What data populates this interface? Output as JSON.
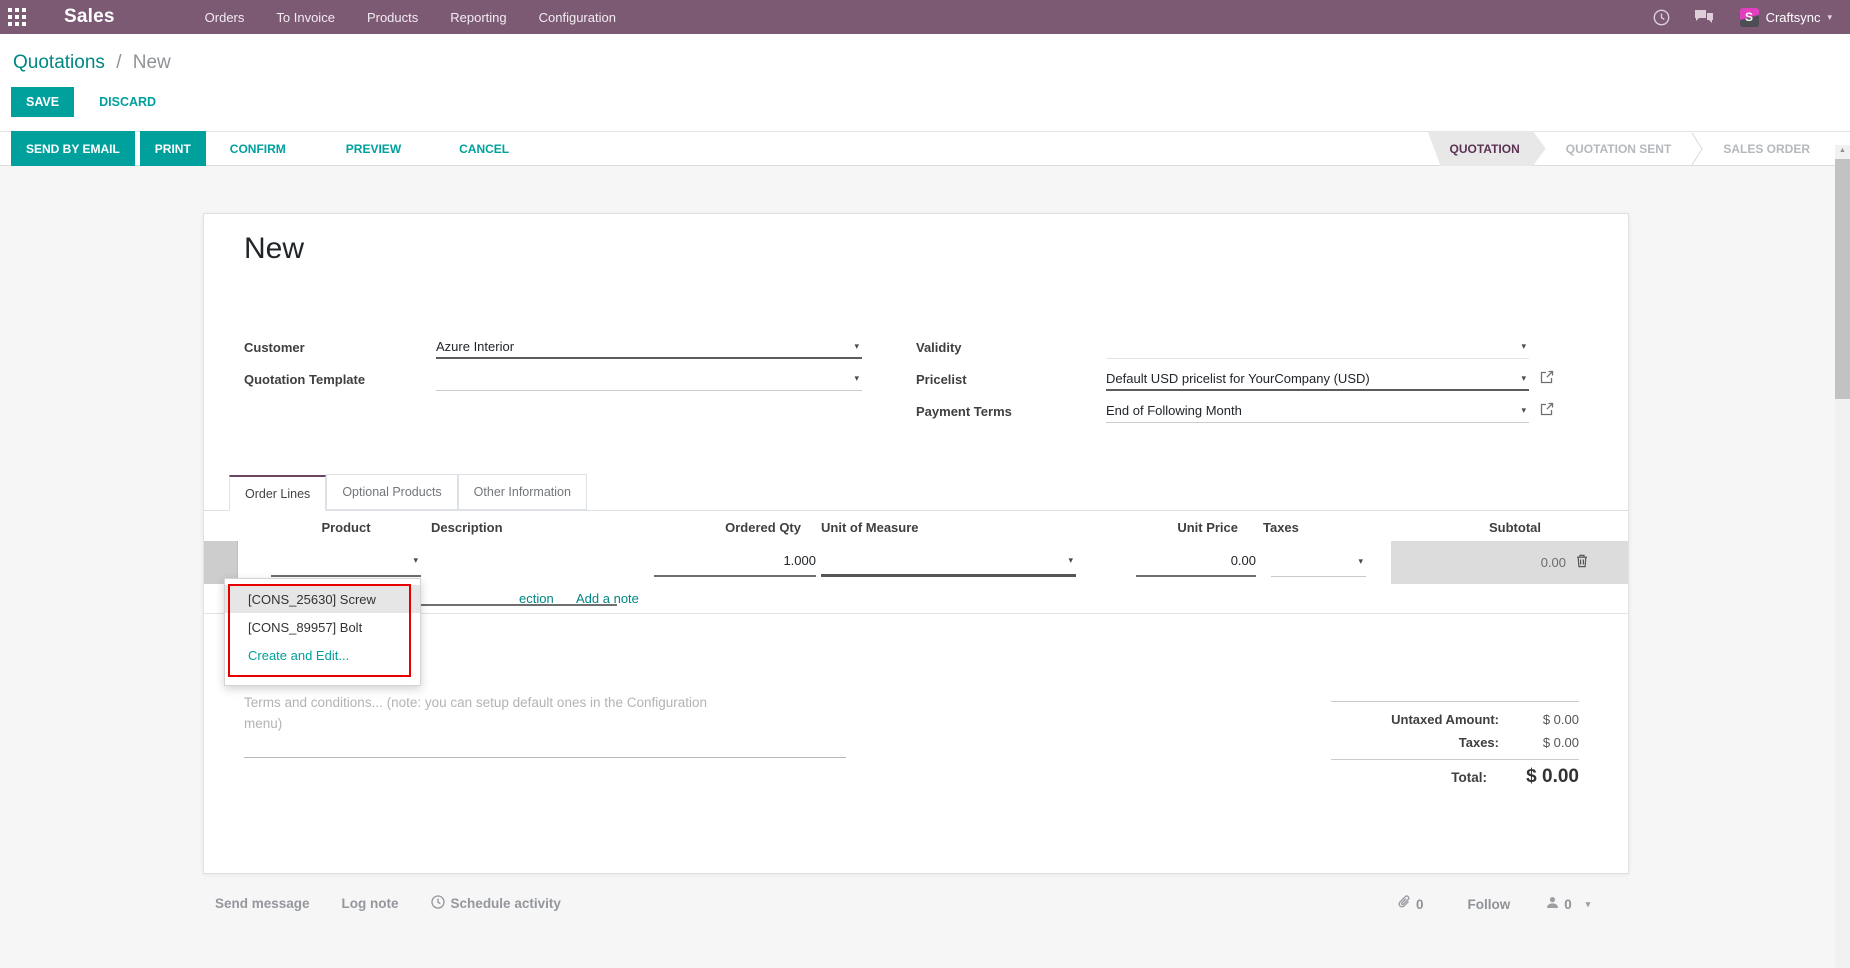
{
  "topbar": {
    "app_name": "Sales",
    "menu": [
      "Orders",
      "To Invoice",
      "Products",
      "Reporting",
      "Configuration"
    ],
    "user_name": "Craftsync",
    "avatar_letter": "S"
  },
  "breadcrumb": {
    "section": "Quotations",
    "separator": "/",
    "current": "New"
  },
  "control_buttons": {
    "save": "SAVE",
    "discard": "DISCARD"
  },
  "statusbar": {
    "send_by_email": "SEND BY EMAIL",
    "print": "PRINT",
    "confirm": "CONFIRM",
    "preview": "PREVIEW",
    "cancel": "CANCEL",
    "stages": [
      "QUOTATION",
      "QUOTATION SENT",
      "SALES ORDER"
    ],
    "active_stage": "QUOTATION"
  },
  "form": {
    "title": "New",
    "customer": {
      "label": "Customer",
      "value": "Azure Interior"
    },
    "quotation_template": {
      "label": "Quotation Template",
      "value": ""
    },
    "validity": {
      "label": "Validity",
      "value": ""
    },
    "pricelist": {
      "label": "Pricelist",
      "value": "Default USD pricelist for YourCompany (USD)"
    },
    "payment_terms": {
      "label": "Payment Terms",
      "value": "End of Following Month"
    }
  },
  "tabs": [
    "Order Lines",
    "Optional Products",
    "Other Information"
  ],
  "order_lines": {
    "columns": [
      "Product",
      "Description",
      "Ordered Qty",
      "Unit of Measure",
      "Unit Price",
      "Taxes",
      "Subtotal"
    ],
    "row": {
      "ordered_qty": "1.000",
      "unit_price": "0.00",
      "subtotal": "0.00"
    },
    "links": {
      "add_section_partial": "ection",
      "add_note": "Add a note"
    }
  },
  "product_dropdown": {
    "options": [
      "[CONS_25630] Screw",
      "[CONS_89957] Bolt"
    ],
    "create_option": "Create and Edit..."
  },
  "terms": {
    "placeholder": "Terms and conditions... (note: you can setup default ones in the Configuration menu)"
  },
  "totals": {
    "untaxed_label": "Untaxed Amount:",
    "untaxed_value": "$ 0.00",
    "taxes_label": "Taxes:",
    "taxes_value": "$ 0.00",
    "total_label": "Total:",
    "total_value": "$ 0.00"
  },
  "chatter": {
    "send_message": "Send message",
    "log_note": "Log note",
    "schedule_activity": "Schedule activity",
    "attachment_count": "0",
    "follow": "Follow",
    "follower_count": "0"
  },
  "icons": {
    "caret_down": "▾",
    "scroll_up": "▲"
  },
  "colors": {
    "primary_purple": "#7d5a74",
    "accent_teal": "#00a09d",
    "link_teal": "#008784",
    "stage_active_text": "#5d3354",
    "annotation_red": "#e80000"
  }
}
